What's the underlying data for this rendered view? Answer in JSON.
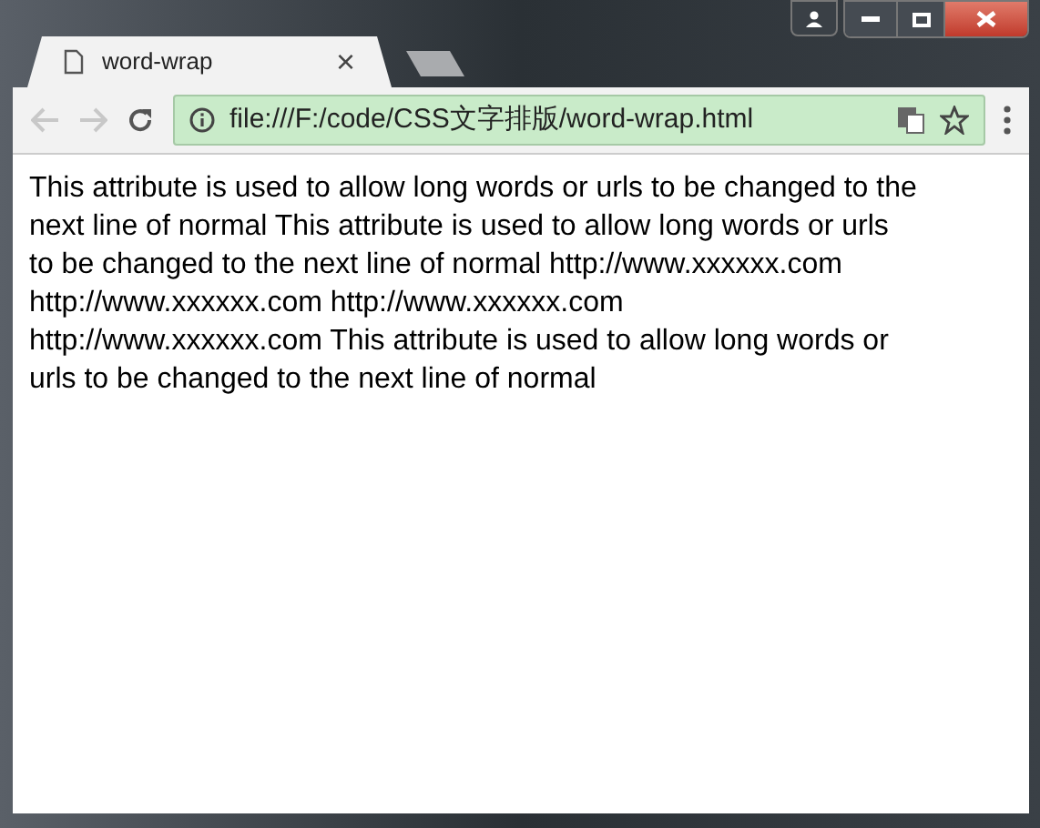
{
  "tab": {
    "title": "word-wrap",
    "close": "×"
  },
  "address_bar": {
    "url": "file:///F:/code/CSS文字排版/word-wrap.html"
  },
  "content": {
    "lines": [
      "This attribute is used to allow long words or urls to be changed to the",
      "next line of normal This attribute is used to allow long words or urls",
      "to be changed to the next line of normal http://www.xxxxxx.com",
      "http://www.xxxxxx.com http://www.xxxxxx.com",
      "http://www.xxxxxx.com This attribute is used to allow long words or",
      "urls to be changed to the next line of normal"
    ]
  }
}
